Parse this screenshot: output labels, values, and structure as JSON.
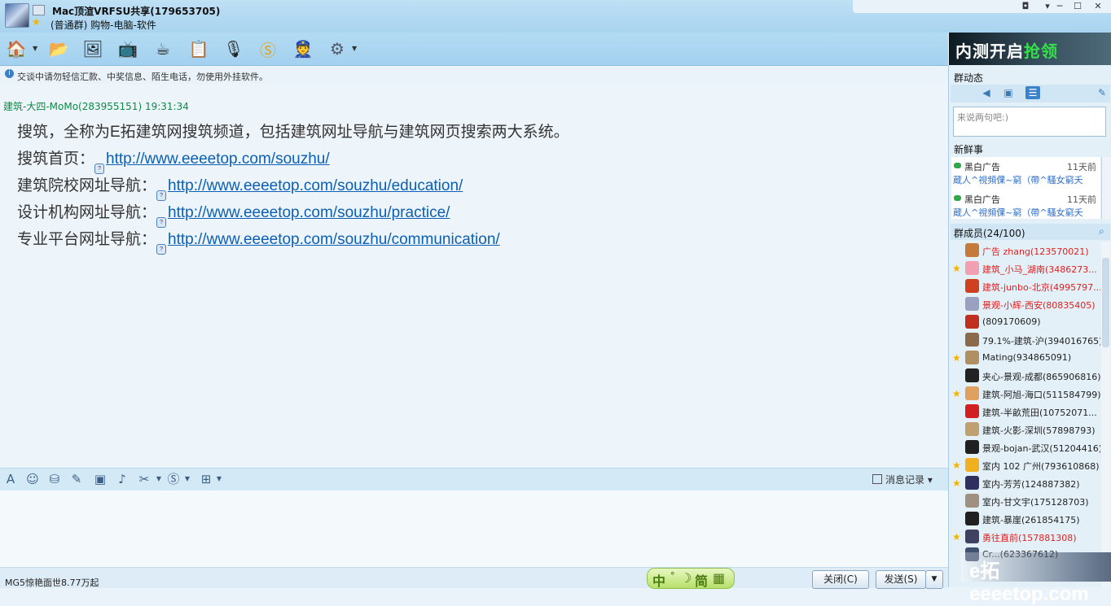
{
  "window": {
    "title": "Mac顶渲VRFSU共享(179653705)",
    "subtitle": "(普通群) 购物-电脑-软件",
    "controls": [
      "◘",
      "▾",
      "─",
      "☐",
      "✕"
    ]
  },
  "toolbar": {
    "icons": [
      "home-icon",
      "folder-icon",
      "album-icon",
      "video-icon",
      "coffee-icon",
      "list-add-icon",
      "microphone-icon",
      "s-app-icon",
      "officer-icon",
      "settings-icon"
    ],
    "glyphs": [
      "🏠",
      "📂",
      "🖼",
      "📺",
      "☕",
      "📋",
      "🎙",
      "Ⓢ",
      "👮",
      "⚙"
    ]
  },
  "ad_banner": {
    "text_part1": "内测开启",
    "text_part2": "抢领"
  },
  "notice": "交谈中请勿轻信汇款、中奖信息、陌生电话，勿使用外挂软件。",
  "chat": {
    "sender": "建筑-大四-MoMo(283955151)  19:31:34",
    "lines": [
      {
        "text": "搜筑，全称为E拓建筑网搜筑频道，包括建筑网址导航与建筑网页搜索两大系统。",
        "link": ""
      },
      {
        "text": "搜筑首页：",
        "link": "http://www.eeeetop.com/souzhu/"
      },
      {
        "text": "建筑院校网址导航：",
        "link": "http://www.eeeetop.com/souzhu/education/"
      },
      {
        "text": "设计机构网址导航：",
        "link": "http://www.eeeetop.com/souzhu/practice/"
      },
      {
        "text": "专业平台网址导航：",
        "link": "http://www.eeeetop.com/souzhu/communication/"
      }
    ]
  },
  "input_toolbar": {
    "icons": [
      "font-icon",
      "emoji-icon",
      "gift-icon",
      "edit-icon",
      "image-icon",
      "music-icon",
      "scissors-icon",
      "s-icon",
      "screen-icon"
    ],
    "glyphs": [
      "A",
      "☺",
      "⛁",
      "✎",
      "▣",
      "♪",
      "✂",
      "Ⓢ",
      "⊞"
    ],
    "history_label": "消息记录"
  },
  "bottom": {
    "ad_text": "MG5惊艳面世8.77万起",
    "ime_chars": [
      "中",
      "°",
      "☽",
      "简",
      "▦"
    ],
    "close_button": "关闭(C)",
    "send_button": "发送(S)"
  },
  "right_panel": {
    "group_dynamics": "群动态",
    "say_placeholder": "来说两句吧:)",
    "news_title": "新鲜事",
    "news": [
      {
        "title": "黑白广告",
        "time": "11天前",
        "body": "蔵人^視頻倮~窮（帶^騷女窮夭"
      },
      {
        "title": "黑白广告",
        "time": "11天前",
        "body": "蔵人^視頻倮~窮（帶^騷女窮夭"
      }
    ],
    "members_title": "群成员(24/100)",
    "members": [
      {
        "name": "广告 zhang(123570021)",
        "red": true,
        "star": false,
        "color": "#c47a3a"
      },
      {
        "name": "建筑_小马_湖南(3486273...",
        "red": true,
        "star": true,
        "color": "#f0a0b0"
      },
      {
        "name": "建筑-junbo-北京(4995797...",
        "red": true,
        "star": false,
        "color": "#d04020"
      },
      {
        "name": "景观-小辉-西安(80835405)",
        "red": true,
        "star": false,
        "color": "#9aa0c0"
      },
      {
        "name": "        (809170609)",
        "red": false,
        "star": false,
        "color": "#c03020"
      },
      {
        "name": "79.1%-建筑-沪(394016765)",
        "red": false,
        "star": false,
        "color": "#8a6a4a"
      },
      {
        "name": "Mating(934865091)",
        "red": false,
        "star": true,
        "color": "#b09060"
      },
      {
        "name": "夹心-景观-成都(865906816)",
        "red": false,
        "star": false,
        "color": "#222222"
      },
      {
        "name": "建筑-阿旭-海口(511584799)",
        "red": false,
        "star": true,
        "color": "#e0a060"
      },
      {
        "name": "建筑-半畝荒田(10752071...",
        "red": false,
        "star": false,
        "color": "#d02020"
      },
      {
        "name": "建筑-火影-深圳(57898793)",
        "red": false,
        "star": false,
        "color": "#c0a070"
      },
      {
        "name": "景观-bojan-武汉(51204416)",
        "red": false,
        "star": false,
        "color": "#202020"
      },
      {
        "name": "室内  102  广州(793610868)",
        "red": false,
        "star": true,
        "color": "#f0b020"
      },
      {
        "name": "室内-芳芳(124887382)",
        "red": false,
        "star": true,
        "color": "#303060"
      },
      {
        "name": "室内-甘文宇(175128703)",
        "red": false,
        "star": false,
        "color": "#a09080"
      },
      {
        "name": "建筑-暴崖(261854175)",
        "red": false,
        "star": false,
        "color": "#202020"
      },
      {
        "name": "勇往直前(157881308)",
        "red": true,
        "star": true,
        "color": "#404060"
      },
      {
        "name": "Cr...(623367612)",
        "red": false,
        "star": false,
        "color": "#405070"
      }
    ]
  },
  "watermark": "e拓eeeetop.com"
}
